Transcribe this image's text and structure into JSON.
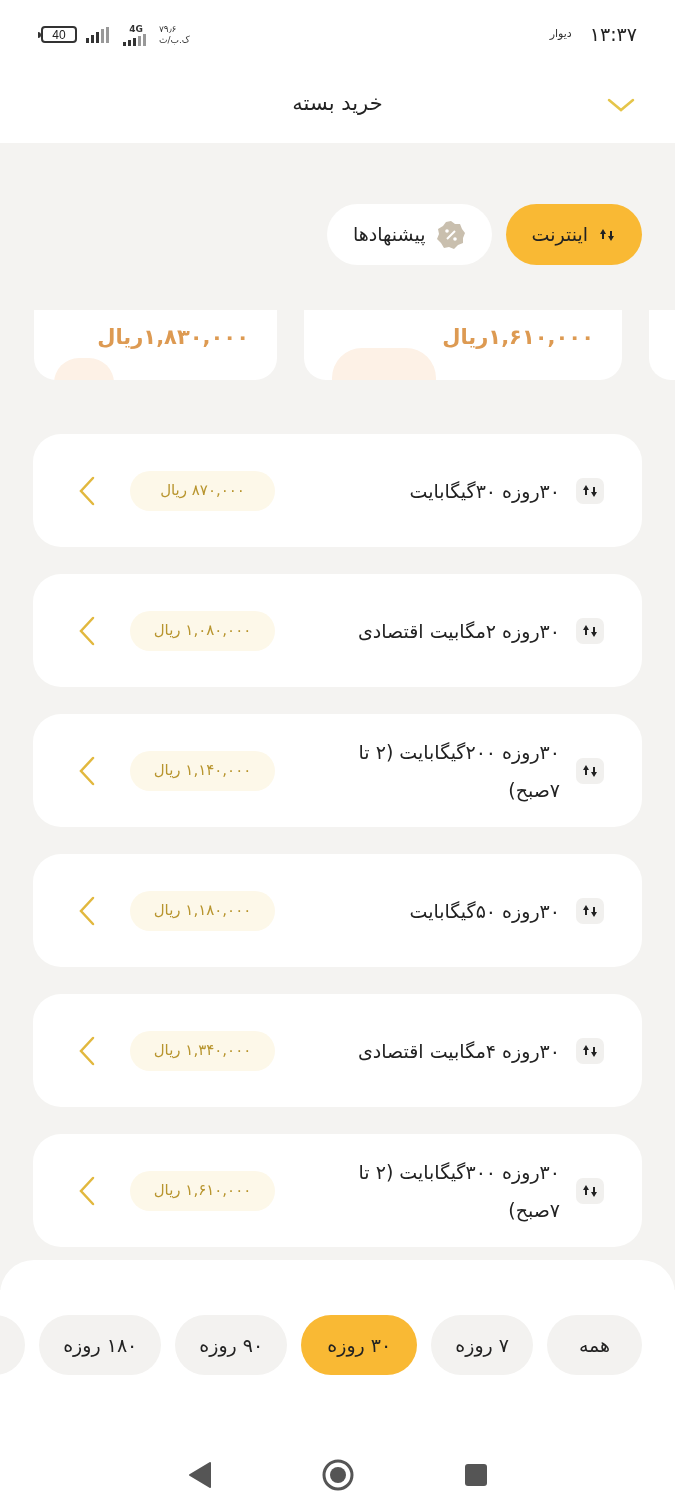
{
  "status_bar": {
    "time": "۱۳:۳۷",
    "app_label": "دیوار",
    "net_speed": "۷۹٫۶",
    "net_unit": "ک.ب/ث",
    "network": "4G",
    "battery": "40"
  },
  "header": {
    "title": "خرید بسته"
  },
  "tabs": [
    {
      "label": "اینترنت",
      "kind": "internet",
      "selected": true
    },
    {
      "label": "پیشنهادها",
      "kind": "offers",
      "selected": false
    }
  ],
  "featured_cards": [
    {
      "price": "۱,۶۱۰,۰۰۰ریال"
    },
    {
      "price": "۱,۸۳۰,۰۰۰ریال"
    }
  ],
  "plans": [
    {
      "title": "۳۰روزه ۳۰گیگابایت",
      "price": "۸۷۰,۰۰۰ ریال"
    },
    {
      "title": "۳۰روزه ۲مگابیت اقتصادی",
      "price": "۱,۰۸۰,۰۰۰ ریال"
    },
    {
      "title": "۳۰روزه ۲۰۰گیگابایت (۲ تا ۷صبح)",
      "price": "۱,۱۴۰,۰۰۰ ریال"
    },
    {
      "title": "۳۰روزه ۵۰گیگابایت",
      "price": "۱,۱۸۰,۰۰۰ ریال"
    },
    {
      "title": "۳۰روزه ۴مگابیت اقتصادی",
      "price": "۱,۳۴۰,۰۰۰ ریال"
    },
    {
      "title": "۳۰روزه ۳۰۰گیگابایت (۲ تا ۷صبح)",
      "price": "۱,۶۱۰,۰۰۰ ریال"
    }
  ],
  "duration_filters": [
    {
      "label": "همه",
      "selected": false
    },
    {
      "label": "۷ روزه",
      "selected": false
    },
    {
      "label": "۳۰ روزه",
      "selected": true
    },
    {
      "label": "۹۰ روزه",
      "selected": false
    },
    {
      "label": "۱۸۰ روزه",
      "selected": false
    }
  ]
}
